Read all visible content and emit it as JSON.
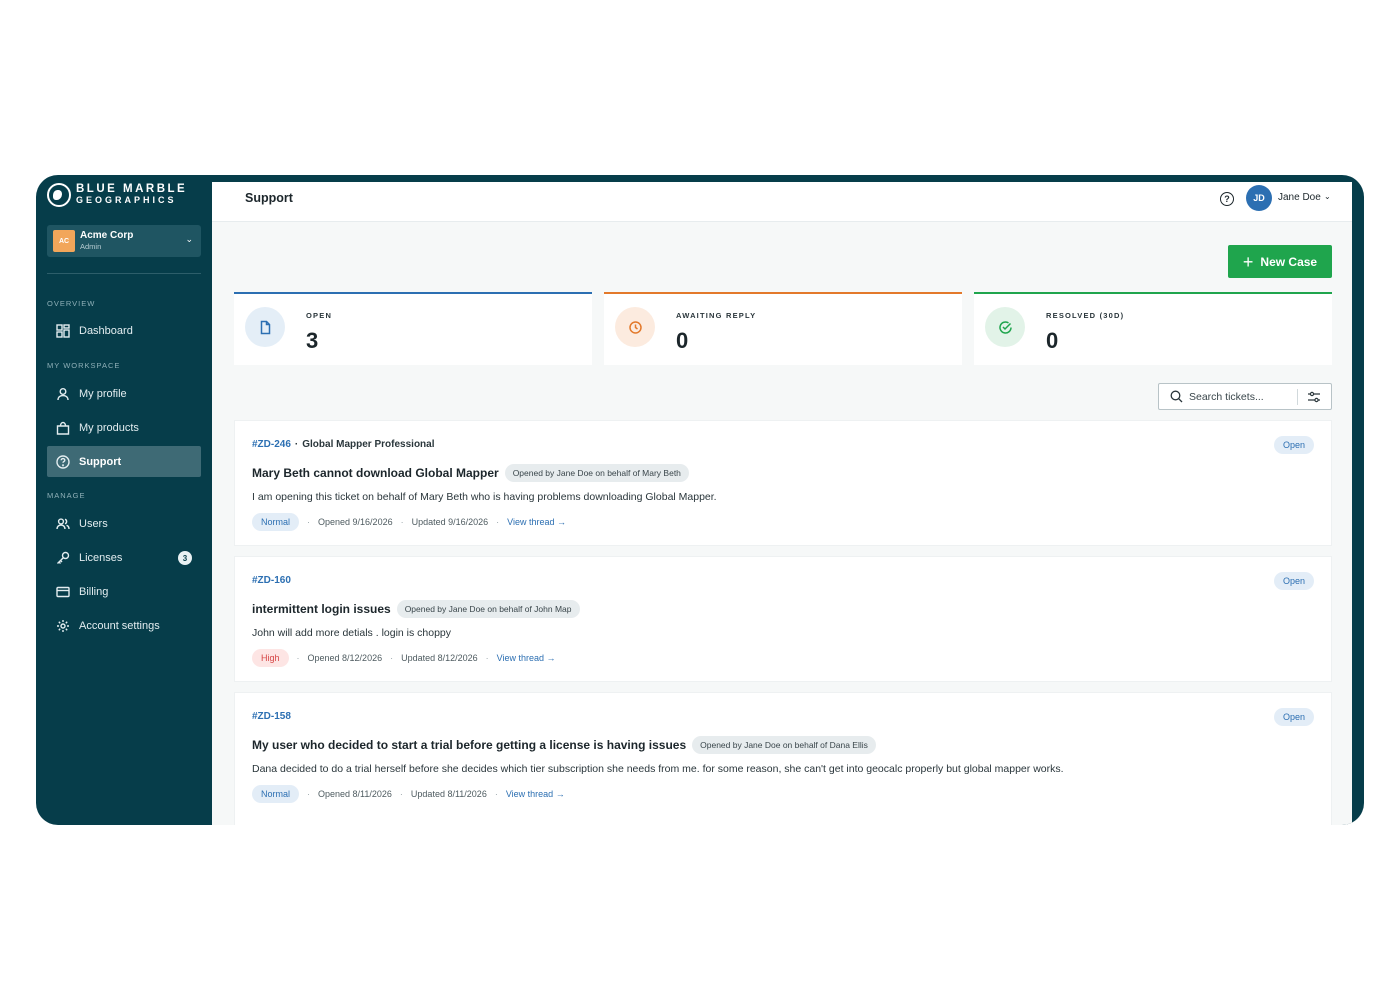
{
  "brand": {
    "line1": "BLUE MARBLE",
    "line2": "GEOGRAPHICS"
  },
  "org": {
    "avatar": "AC",
    "name": "Acme Corp",
    "role": "Admin"
  },
  "sidebar": {
    "sections": {
      "overview": "OVERVIEW",
      "workspace": "MY WORKSPACE",
      "manage": "MANAGE"
    },
    "items": [
      {
        "label": "Dashboard",
        "icon": "grid-icon"
      },
      {
        "label": "My profile",
        "icon": "user-icon"
      },
      {
        "label": "My products",
        "icon": "bag-icon"
      },
      {
        "label": "Support",
        "icon": "help-circle-icon",
        "active": true
      },
      {
        "label": "Users",
        "icon": "users-icon"
      },
      {
        "label": "Licenses",
        "icon": "key-icon",
        "badge": "3"
      },
      {
        "label": "Billing",
        "icon": "card-icon"
      },
      {
        "label": "Account settings",
        "icon": "gear-icon"
      }
    ]
  },
  "header": {
    "title": "Support",
    "help": "?",
    "user_initials": "JD",
    "user_name": "Jane Doe"
  },
  "actions": {
    "new_case": "New Case"
  },
  "stats": [
    {
      "label": "OPEN",
      "value": "3",
      "color": "#2c6fb2"
    },
    {
      "label": "AWAITING REPLY",
      "value": "0",
      "color": "#e3792b"
    },
    {
      "label": "RESOLVED (30D)",
      "value": "0",
      "color": "#1fa54d"
    }
  ],
  "search": {
    "placeholder": "Search tickets..."
  },
  "tickets": [
    {
      "id": "#ZD-246",
      "product": "Global Mapper Professional",
      "status": "Open",
      "title": "Mary Beth cannot download Global Mapper",
      "behalf": "Opened by Jane Doe on behalf of Mary Beth",
      "description": "I am opening this ticket on behalf of Mary Beth who is having problems downloading Global Mapper.",
      "priority": "Normal",
      "opened": "Opened 9/16/2026",
      "updated": "Updated 9/16/2026",
      "link": "View thread →"
    },
    {
      "id": "#ZD-160",
      "product": "",
      "status": "Open",
      "title": "intermittent login issues",
      "behalf": "Opened by Jane Doe on behalf of John Map",
      "description": "John will add more detials . login is choppy",
      "priority": "High",
      "opened": "Opened 8/12/2026",
      "updated": "Updated 8/12/2026",
      "link": "View thread →"
    },
    {
      "id": "#ZD-158",
      "product": "",
      "status": "Open",
      "title": "My user who decided to start a trial before getting a license is having issues",
      "behalf": "Opened by Jane Doe on behalf of Dana Ellis",
      "description": "Dana decided to do a trial herself before she decides which tier subscription she needs from me. for some reason, she can't get into geocalc properly but global mapper works.",
      "priority": "Normal",
      "opened": "Opened 8/11/2026",
      "updated": "Updated 8/11/2026",
      "link": "View thread →"
    }
  ]
}
